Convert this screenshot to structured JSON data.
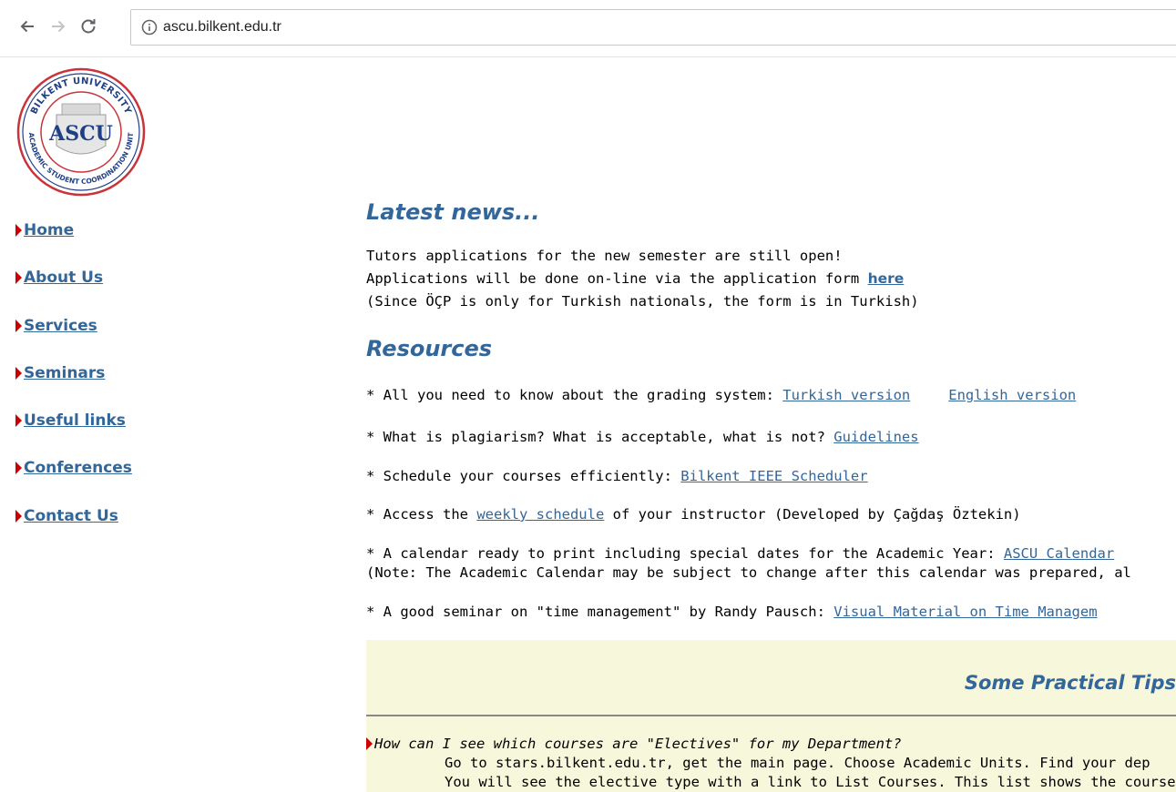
{
  "browser": {
    "url": "ascu.bilkent.edu.tr",
    "icons": {
      "back": "arrow-left-icon",
      "forward": "arrow-right-icon",
      "reload": "reload-icon",
      "info": "info-circle-icon"
    }
  },
  "logo": {
    "text": "ASCU",
    "ring_top": "BILKENT UNIVERSITY",
    "ring_bottom": "ACADEMIC STUDENT COORDINATION UNIT"
  },
  "colors": {
    "link": "#336699",
    "bullet": "#cc0000",
    "tips_bg": "#f7f7dc"
  },
  "sidebar": {
    "items": [
      {
        "label": " Home"
      },
      {
        "label": " About Us"
      },
      {
        "label": " Services"
      },
      {
        "label": " Seminars"
      },
      {
        "label": " Useful links"
      },
      {
        "label": " Conferences"
      },
      {
        "label": " Contact Us"
      }
    ]
  },
  "news": {
    "title": "Latest news...",
    "line1": "Tutors applications for the new semester are still open!",
    "line2_pre": "Applications will be done on-line via the application form ",
    "line2_link": "here",
    "line3": "(Since ÖÇP is only for Turkish nationals, the form is in Turkish)"
  },
  "resources": {
    "title": "Resources",
    "r1_pre": "* All you need to know about the grading system: ",
    "r1_link1": "Turkish version",
    "r1_link2": "English version",
    "r2_pre": "* What is plagiarism? What is acceptable, what is not? ",
    "r2_link": "Guidelines",
    "r3_pre": "* Schedule your courses efficiently: ",
    "r3_link": "Bilkent IEEE Scheduler",
    "r4_pre": "* Access the ",
    "r4_link": "weekly schedule",
    "r4_post": " of your instructor (Developed by Çağdaş Öztekin)",
    "r5_pre": "* A calendar ready to print including special dates for the Academic Year: ",
    "r5_link": "ASCU Calendar",
    "r5_note": "(Note: The Academic Calendar may be subject to change after this calendar was prepared, al",
    "r6_pre": "* A good seminar on \"time management\" by Randy Pausch: ",
    "r6_link": "Visual Material on Time Managem"
  },
  "tips": {
    "title": "Some Practical Tips",
    "question": "How can I see which courses are \"Electives\" for my Department?",
    "answer1": "Go to stars.bilkent.edu.tr, get the main page. Choose Academic Units. Find your dep",
    "answer2": "You will see the elective type with a link to List Courses. This list shows the courses w"
  }
}
